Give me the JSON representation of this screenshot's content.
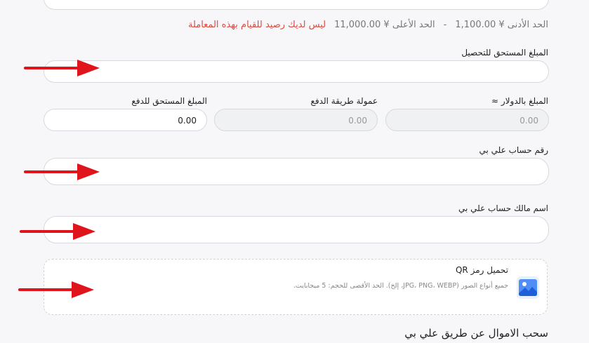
{
  "limits": {
    "min_text": "الحد الأدنى ¥ 1,100.00",
    "separator": "-",
    "max_text": "الحد الأعلى ¥ 11,000.00",
    "error": "ليس لديك رصيد للقيام بهذه المعاملة"
  },
  "fields": {
    "amount_due_label": "المبلغ المستحق للتحصيل",
    "usd_amount_label": "المبلغ بالدولار ≈",
    "usd_amount_value": "0.00",
    "commission_label": "عمولة طريقة الدفع",
    "commission_value": "0.00",
    "payable_label": "المبلغ المستحق للدفع",
    "payable_value": "0.00",
    "account_number_label": "رقم حساب علي بي",
    "account_owner_label": "اسم مالك حساب علي بي"
  },
  "upload": {
    "title": "تحميل رمز QR",
    "description": "جميع أنواع الصور (JPG، PNG، WEBP، إلخ). الحد الأقصى للحجم: 5 ميجابايت.",
    "icon": "image-icon"
  },
  "section": {
    "title": "سحب الاموال عن طريق علي بي"
  },
  "colors": {
    "error": "#e0483e",
    "arrow": "#e0141b",
    "icon_blue": "#3b82f6"
  }
}
